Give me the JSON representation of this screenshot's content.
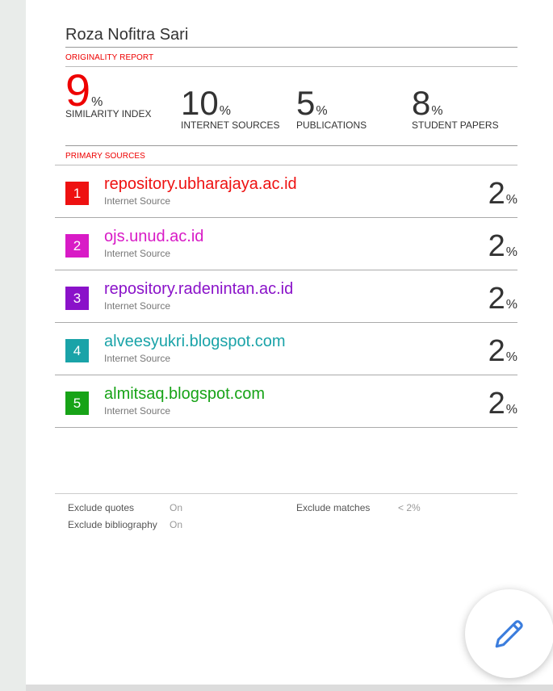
{
  "author": "Roza Nofitra Sari",
  "originality_label": "ORIGINALITY REPORT",
  "metrics": [
    {
      "value": "9",
      "unit": "%",
      "label": "SIMILARITY INDEX"
    },
    {
      "value": "10",
      "unit": "%",
      "label": "INTERNET SOURCES"
    },
    {
      "value": "5",
      "unit": "%",
      "label": "PUBLICATIONS"
    },
    {
      "value": "8",
      "unit": "%",
      "label": "STUDENT PAPERS"
    }
  ],
  "primary_label": "PRIMARY SOURCES",
  "sources": [
    {
      "rank": "1",
      "name": "repository.ubharajaya.ac.id",
      "type": "Internet Source",
      "percent": "2",
      "unit": "%",
      "color": "#ee1111"
    },
    {
      "rank": "2",
      "name": "ojs.unud.ac.id",
      "type": "Internet Source",
      "percent": "2",
      "unit": "%",
      "color": "#d81bc6"
    },
    {
      "rank": "3",
      "name": "repository.radenintan.ac.id",
      "type": "Internet Source",
      "percent": "2",
      "unit": "%",
      "color": "#8a12c9"
    },
    {
      "rank": "4",
      "name": "alveesyukri.blogspot.com",
      "type": "Internet Source",
      "percent": "2",
      "unit": "%",
      "color": "#1aa3a8"
    },
    {
      "rank": "5",
      "name": "almitsaq.blogspot.com",
      "type": "Internet Source",
      "percent": "2",
      "unit": "%",
      "color": "#17a317"
    }
  ],
  "footer": {
    "exclude_quotes_label": "Exclude quotes",
    "exclude_quotes_value": "On",
    "exclude_bibliography_label": "Exclude bibliography",
    "exclude_bibliography_value": "On",
    "exclude_matches_label": "Exclude matches",
    "exclude_matches_value": "< 2%"
  },
  "fab_icon": "pencil-icon",
  "colors": {
    "accent_red": "#ee1111",
    "fab_icon": "#3b7ddd"
  }
}
